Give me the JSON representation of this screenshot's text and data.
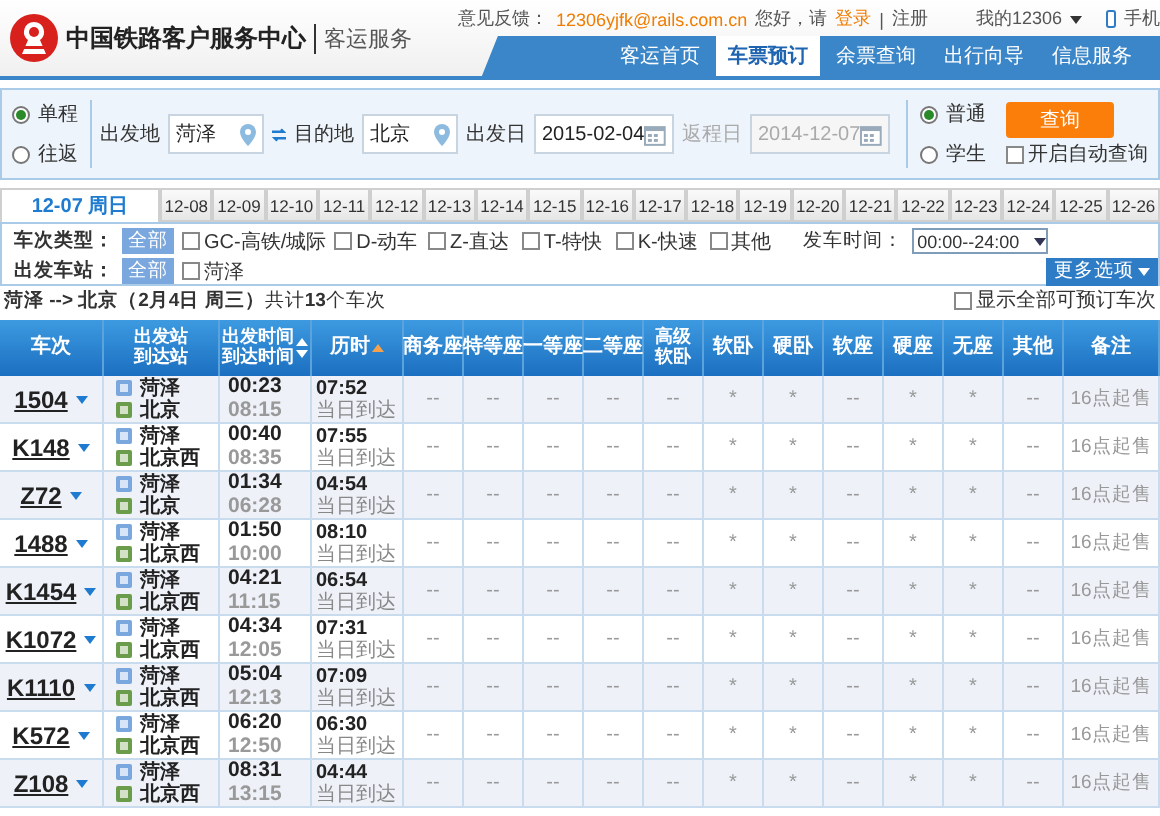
{
  "header": {
    "title": "中国铁路客户服务中心",
    "subtitle": "客运服务",
    "feedback_label": "意见反馈：",
    "feedback_email": "12306yjfk@rails.com.cn",
    "greeting": "您好，请",
    "login": "登录",
    "separator": "|",
    "register": "注册",
    "account": "我的12306",
    "mobile": "手机"
  },
  "nav": [
    {
      "label": "客运首页",
      "selected": false
    },
    {
      "label": "车票预订",
      "selected": true
    },
    {
      "label": "余票查询",
      "selected": false
    },
    {
      "label": "出行向导",
      "selected": false
    },
    {
      "label": "信息服务",
      "selected": false
    }
  ],
  "search": {
    "trip": [
      {
        "label": "单程",
        "selected": true
      },
      {
        "label": "往返",
        "selected": false
      }
    ],
    "from_label": "出发地",
    "from": "菏泽",
    "to_label": "目的地",
    "to": "北京",
    "date_label": "出发日",
    "date": "2015-02-04",
    "return_label": "返程日",
    "return_date": "2014-12-07",
    "return_disabled": true,
    "passenger": [
      {
        "label": "普通",
        "selected": true
      },
      {
        "label": "学生",
        "selected": false
      }
    ],
    "query_button": "查询",
    "auto_query": {
      "label": "开启自动查询",
      "checked": false
    }
  },
  "date_tabs": [
    {
      "label": "12-07 周日",
      "selected": true
    },
    {
      "label": "12-08",
      "selected": false
    },
    {
      "label": "12-09",
      "selected": false
    },
    {
      "label": "12-10",
      "selected": false
    },
    {
      "label": "12-11",
      "selected": false
    },
    {
      "label": "12-12",
      "selected": false
    },
    {
      "label": "12-13",
      "selected": false
    },
    {
      "label": "12-14",
      "selected": false
    },
    {
      "label": "12-15",
      "selected": false
    },
    {
      "label": "12-16",
      "selected": false
    },
    {
      "label": "12-17",
      "selected": false
    },
    {
      "label": "12-18",
      "selected": false
    },
    {
      "label": "12-19",
      "selected": false
    },
    {
      "label": "12-20",
      "selected": false
    },
    {
      "label": "12-21",
      "selected": false
    },
    {
      "label": "12-22",
      "selected": false
    },
    {
      "label": "12-23",
      "selected": false
    },
    {
      "label": "12-24",
      "selected": false
    },
    {
      "label": "12-25",
      "selected": false
    },
    {
      "label": "12-26",
      "selected": false
    }
  ],
  "filters": {
    "type_label": "车次类型：",
    "type_all": {
      "label": "全部",
      "selected": true
    },
    "types": [
      {
        "label": "GC-高铁/城际",
        "checked": false
      },
      {
        "label": "D-动车",
        "checked": false
      },
      {
        "label": "Z-直达",
        "checked": false
      },
      {
        "label": "T-特快",
        "checked": false
      },
      {
        "label": "K-快速",
        "checked": false
      },
      {
        "label": "其他",
        "checked": false
      }
    ],
    "time_label": "发车时间：",
    "time_value": "00:00--24:00",
    "station_label": "出发车站：",
    "station_all": {
      "label": "全部",
      "selected": true
    },
    "stations": [
      {
        "label": "菏泽",
        "checked": false
      }
    ],
    "more_button": "更多选项"
  },
  "summary": {
    "text": "**菏泽 --> 北京（2月4日  周三）**共计**13**个车次",
    "show_all": {
      "label": "显示全部可预订车次",
      "checked": false
    }
  },
  "table": {
    "columns": [
      {
        "label": "车次"
      },
      {
        "label": "出发站",
        "label2": "到达站"
      },
      {
        "label": "出发时间",
        "label2": "到达时间",
        "sortable": true,
        "sort_active": false
      },
      {
        "label": "历时",
        "sortable": true,
        "sort_active": true
      },
      {
        "label": "商务座"
      },
      {
        "label": "特等座"
      },
      {
        "label": "一等座"
      },
      {
        "label": "二等座"
      },
      {
        "label": "高级",
        "label2": "软卧"
      },
      {
        "label": "软卧"
      },
      {
        "label": "硬卧"
      },
      {
        "label": "软座"
      },
      {
        "label": "硬座"
      },
      {
        "label": "无座"
      },
      {
        "label": "其他"
      },
      {
        "label": "备注"
      }
    ],
    "rows": [
      {
        "train": "1504",
        "from": "菏泽",
        "to": "北京",
        "depart": "00:23",
        "arrive": "08:15",
        "duration": "07:52",
        "arrival_day": "当日到达",
        "seats": [
          "--",
          "--",
          "--",
          "--",
          "--",
          "*",
          "*",
          "--",
          "*",
          "*",
          "--"
        ],
        "note": "16点起售"
      },
      {
        "train": "K148",
        "from": "菏泽",
        "to": "北京西",
        "depart": "00:40",
        "arrive": "08:35",
        "duration": "07:55",
        "arrival_day": "当日到达",
        "seats": [
          "--",
          "--",
          "--",
          "--",
          "--",
          "*",
          "*",
          "--",
          "*",
          "*",
          "--"
        ],
        "note": "16点起售"
      },
      {
        "train": "Z72",
        "from": "菏泽",
        "to": "北京",
        "depart": "01:34",
        "arrive": "06:28",
        "duration": "04:54",
        "arrival_day": "当日到达",
        "seats": [
          "--",
          "--",
          "--",
          "--",
          "--",
          "*",
          "*",
          "--",
          "*",
          "*",
          "--"
        ],
        "note": "16点起售"
      },
      {
        "train": "1488",
        "from": "菏泽",
        "to": "北京西",
        "depart": "01:50",
        "arrive": "10:00",
        "duration": "08:10",
        "arrival_day": "当日到达",
        "seats": [
          "--",
          "--",
          "--",
          "--",
          "--",
          "*",
          "*",
          "--",
          "*",
          "*",
          "--"
        ],
        "note": "16点起售"
      },
      {
        "train": "K1454",
        "from": "菏泽",
        "to": "北京西",
        "depart": "04:21",
        "arrive": "11:15",
        "duration": "06:54",
        "arrival_day": "当日到达",
        "seats": [
          "--",
          "--",
          "--",
          "--",
          "--",
          "*",
          "*",
          "--",
          "*",
          "*",
          "--"
        ],
        "note": "16点起售"
      },
      {
        "train": "K1072",
        "from": "菏泽",
        "to": "北京西",
        "depart": "04:34",
        "arrive": "12:05",
        "duration": "07:31",
        "arrival_day": "当日到达",
        "seats": [
          "--",
          "--",
          "--",
          "--",
          "--",
          "*",
          "*",
          "--",
          "*",
          "*",
          "--"
        ],
        "note": "16点起售"
      },
      {
        "train": "K1110",
        "from": "菏泽",
        "to": "北京西",
        "depart": "05:04",
        "arrive": "12:13",
        "duration": "07:09",
        "arrival_day": "当日到达",
        "seats": [
          "--",
          "--",
          "--",
          "--",
          "--",
          "*",
          "*",
          "--",
          "*",
          "*",
          "--"
        ],
        "note": "16点起售"
      },
      {
        "train": "K572",
        "from": "菏泽",
        "to": "北京西",
        "depart": "06:20",
        "arrive": "12:50",
        "duration": "06:30",
        "arrival_day": "当日到达",
        "seats": [
          "--",
          "--",
          "--",
          "--",
          "--",
          "*",
          "*",
          "--",
          "*",
          "*",
          "--"
        ],
        "note": "16点起售"
      },
      {
        "train": "Z108",
        "from": "菏泽",
        "to": "北京西",
        "depart": "08:31",
        "arrive": "13:15",
        "duration": "04:44",
        "arrival_day": "当日到达",
        "seats": [
          "--",
          "--",
          "--",
          "--",
          "--",
          "*",
          "*",
          "--",
          "*",
          "*",
          "--"
        ],
        "note": "16点起售"
      }
    ]
  }
}
